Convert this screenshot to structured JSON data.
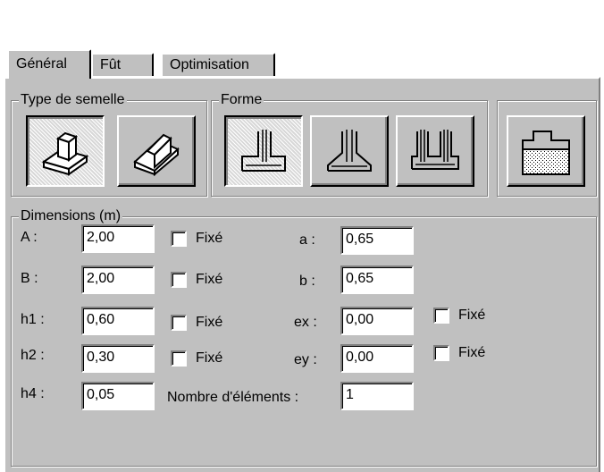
{
  "tabs": [
    {
      "label": "Général",
      "active": true
    },
    {
      "label": "Fût",
      "active": false
    },
    {
      "label": "Optimisation",
      "active": false
    }
  ],
  "type_semelle": {
    "legend": "Type de semelle",
    "buttons": [
      {
        "icon": "isolated-footing-icon",
        "pressed": true
      },
      {
        "icon": "strip-footing-icon",
        "pressed": false
      }
    ]
  },
  "forme": {
    "legend": "Forme",
    "buttons": [
      {
        "icon": "eccentric-footing-shape-icon",
        "pressed": true
      },
      {
        "icon": "tapered-footing-shape-icon",
        "pressed": false
      },
      {
        "icon": "multi-column-footing-shape-icon",
        "pressed": false
      }
    ]
  },
  "soil_button": {
    "icon": "footing-on-soil-icon"
  },
  "dimensions": {
    "legend": "Dimensions (m)",
    "fixe_label": "Fixé",
    "rows": [
      {
        "label": "A :",
        "value": "2,00",
        "fixe": false
      },
      {
        "label": "B :",
        "value": "2,00",
        "fixe": false
      },
      {
        "label": "h1 :",
        "value": "0,60",
        "fixe": false
      },
      {
        "label": "h2 :",
        "value": "0,30",
        "fixe": false
      },
      {
        "label": "h4 :",
        "value": "0,05"
      }
    ],
    "right_rows": [
      {
        "label": "a :",
        "value": "0,65"
      },
      {
        "label": "b :",
        "value": "0,65"
      },
      {
        "label": "ex :",
        "value": "0,00",
        "fixe": false
      },
      {
        "label": "ey :",
        "value": "0,00",
        "fixe": false
      }
    ],
    "nombre_label": "Nombre d'éléments :",
    "nombre_value": "1"
  }
}
